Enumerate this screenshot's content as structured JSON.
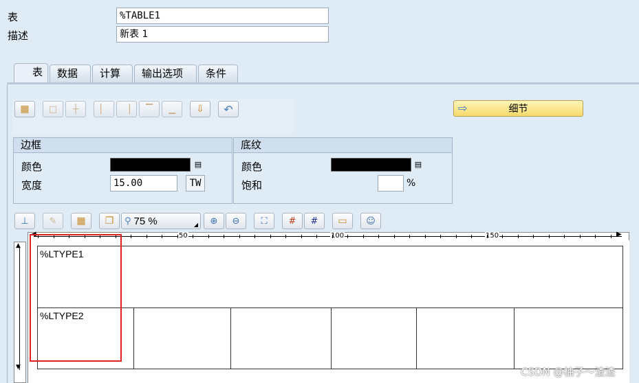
{
  "form": {
    "table_label": "表",
    "table_value": "%TABLE1",
    "desc_label": "描述",
    "desc_value": "新表 1"
  },
  "tabs": [
    {
      "label": "表",
      "active": true
    },
    {
      "label": "数据",
      "active": false
    },
    {
      "label": "计算",
      "active": false
    },
    {
      "label": "输出选项",
      "active": false
    },
    {
      "label": "条件",
      "active": false
    }
  ],
  "toolbar1": {
    "details_label": "细节"
  },
  "border_group": {
    "title": "边框",
    "color_label": "颜色",
    "color_value": "#000000",
    "width_label": "宽度",
    "width_value": "15.00",
    "unit_value": "TW"
  },
  "shading_group": {
    "title": "底纹",
    "color_label": "颜色",
    "color_value": "#000000",
    "saturation_label": "饱和",
    "saturation_value": "",
    "percent_sign": "%"
  },
  "toolbar2": {
    "zoom_value": "75 %"
  },
  "ruler": {
    "labels": [
      "50",
      "100",
      "150"
    ]
  },
  "table_layout": {
    "line_types": [
      "%LTYPE1",
      "%LTYPE2"
    ]
  },
  "watermark": "CSDN @柚子～渣渣",
  "colors": {
    "highlight_box": "#e02020",
    "background": "#dfebf5"
  }
}
